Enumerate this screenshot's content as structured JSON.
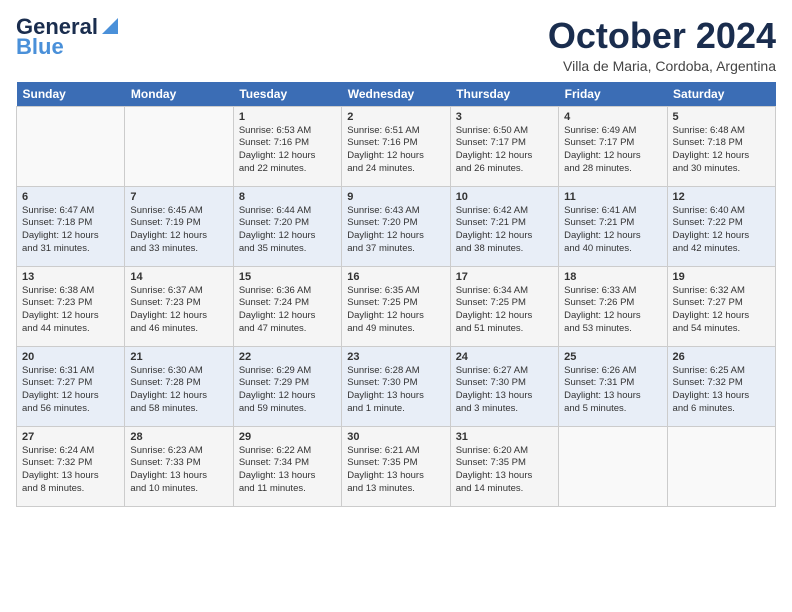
{
  "header": {
    "logo_line1": "General",
    "logo_line2": "Blue",
    "month": "October 2024",
    "location": "Villa de Maria, Cordoba, Argentina"
  },
  "days_of_week": [
    "Sunday",
    "Monday",
    "Tuesday",
    "Wednesday",
    "Thursday",
    "Friday",
    "Saturday"
  ],
  "weeks": [
    [
      {
        "day": "",
        "info": ""
      },
      {
        "day": "",
        "info": ""
      },
      {
        "day": "1",
        "info": "Sunrise: 6:53 AM\nSunset: 7:16 PM\nDaylight: 12 hours\nand 22 minutes."
      },
      {
        "day": "2",
        "info": "Sunrise: 6:51 AM\nSunset: 7:16 PM\nDaylight: 12 hours\nand 24 minutes."
      },
      {
        "day": "3",
        "info": "Sunrise: 6:50 AM\nSunset: 7:17 PM\nDaylight: 12 hours\nand 26 minutes."
      },
      {
        "day": "4",
        "info": "Sunrise: 6:49 AM\nSunset: 7:17 PM\nDaylight: 12 hours\nand 28 minutes."
      },
      {
        "day": "5",
        "info": "Sunrise: 6:48 AM\nSunset: 7:18 PM\nDaylight: 12 hours\nand 30 minutes."
      }
    ],
    [
      {
        "day": "6",
        "info": "Sunrise: 6:47 AM\nSunset: 7:18 PM\nDaylight: 12 hours\nand 31 minutes."
      },
      {
        "day": "7",
        "info": "Sunrise: 6:45 AM\nSunset: 7:19 PM\nDaylight: 12 hours\nand 33 minutes."
      },
      {
        "day": "8",
        "info": "Sunrise: 6:44 AM\nSunset: 7:20 PM\nDaylight: 12 hours\nand 35 minutes."
      },
      {
        "day": "9",
        "info": "Sunrise: 6:43 AM\nSunset: 7:20 PM\nDaylight: 12 hours\nand 37 minutes."
      },
      {
        "day": "10",
        "info": "Sunrise: 6:42 AM\nSunset: 7:21 PM\nDaylight: 12 hours\nand 38 minutes."
      },
      {
        "day": "11",
        "info": "Sunrise: 6:41 AM\nSunset: 7:21 PM\nDaylight: 12 hours\nand 40 minutes."
      },
      {
        "day": "12",
        "info": "Sunrise: 6:40 AM\nSunset: 7:22 PM\nDaylight: 12 hours\nand 42 minutes."
      }
    ],
    [
      {
        "day": "13",
        "info": "Sunrise: 6:38 AM\nSunset: 7:23 PM\nDaylight: 12 hours\nand 44 minutes."
      },
      {
        "day": "14",
        "info": "Sunrise: 6:37 AM\nSunset: 7:23 PM\nDaylight: 12 hours\nand 46 minutes."
      },
      {
        "day": "15",
        "info": "Sunrise: 6:36 AM\nSunset: 7:24 PM\nDaylight: 12 hours\nand 47 minutes."
      },
      {
        "day": "16",
        "info": "Sunrise: 6:35 AM\nSunset: 7:25 PM\nDaylight: 12 hours\nand 49 minutes."
      },
      {
        "day": "17",
        "info": "Sunrise: 6:34 AM\nSunset: 7:25 PM\nDaylight: 12 hours\nand 51 minutes."
      },
      {
        "day": "18",
        "info": "Sunrise: 6:33 AM\nSunset: 7:26 PM\nDaylight: 12 hours\nand 53 minutes."
      },
      {
        "day": "19",
        "info": "Sunrise: 6:32 AM\nSunset: 7:27 PM\nDaylight: 12 hours\nand 54 minutes."
      }
    ],
    [
      {
        "day": "20",
        "info": "Sunrise: 6:31 AM\nSunset: 7:27 PM\nDaylight: 12 hours\nand 56 minutes."
      },
      {
        "day": "21",
        "info": "Sunrise: 6:30 AM\nSunset: 7:28 PM\nDaylight: 12 hours\nand 58 minutes."
      },
      {
        "day": "22",
        "info": "Sunrise: 6:29 AM\nSunset: 7:29 PM\nDaylight: 12 hours\nand 59 minutes."
      },
      {
        "day": "23",
        "info": "Sunrise: 6:28 AM\nSunset: 7:30 PM\nDaylight: 13 hours\nand 1 minute."
      },
      {
        "day": "24",
        "info": "Sunrise: 6:27 AM\nSunset: 7:30 PM\nDaylight: 13 hours\nand 3 minutes."
      },
      {
        "day": "25",
        "info": "Sunrise: 6:26 AM\nSunset: 7:31 PM\nDaylight: 13 hours\nand 5 minutes."
      },
      {
        "day": "26",
        "info": "Sunrise: 6:25 AM\nSunset: 7:32 PM\nDaylight: 13 hours\nand 6 minutes."
      }
    ],
    [
      {
        "day": "27",
        "info": "Sunrise: 6:24 AM\nSunset: 7:32 PM\nDaylight: 13 hours\nand 8 minutes."
      },
      {
        "day": "28",
        "info": "Sunrise: 6:23 AM\nSunset: 7:33 PM\nDaylight: 13 hours\nand 10 minutes."
      },
      {
        "day": "29",
        "info": "Sunrise: 6:22 AM\nSunset: 7:34 PM\nDaylight: 13 hours\nand 11 minutes."
      },
      {
        "day": "30",
        "info": "Sunrise: 6:21 AM\nSunset: 7:35 PM\nDaylight: 13 hours\nand 13 minutes."
      },
      {
        "day": "31",
        "info": "Sunrise: 6:20 AM\nSunset: 7:35 PM\nDaylight: 13 hours\nand 14 minutes."
      },
      {
        "day": "",
        "info": ""
      },
      {
        "day": "",
        "info": ""
      }
    ]
  ]
}
